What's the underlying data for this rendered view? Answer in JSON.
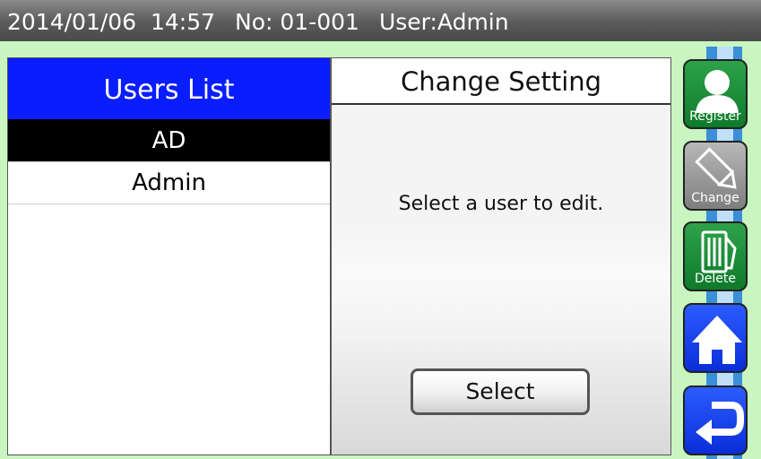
{
  "status": {
    "datetime": "2014/01/06  14:57",
    "number": "No: 01-001",
    "user": "User:Admin"
  },
  "users_panel": {
    "title": "Users List",
    "users": [
      "AD",
      "Admin"
    ]
  },
  "change_panel": {
    "title": "Change Setting",
    "message": "Select a user to edit.",
    "select_label": "Select"
  },
  "sidebar": {
    "register_label": "Register",
    "change_label": "Change",
    "delete_label": "Delete"
  },
  "colors": {
    "title_blue": "#0a1dff",
    "frame_green": "#c8f5c0",
    "button_green": "#1a8a36",
    "button_blue": "#1a3cf0"
  }
}
